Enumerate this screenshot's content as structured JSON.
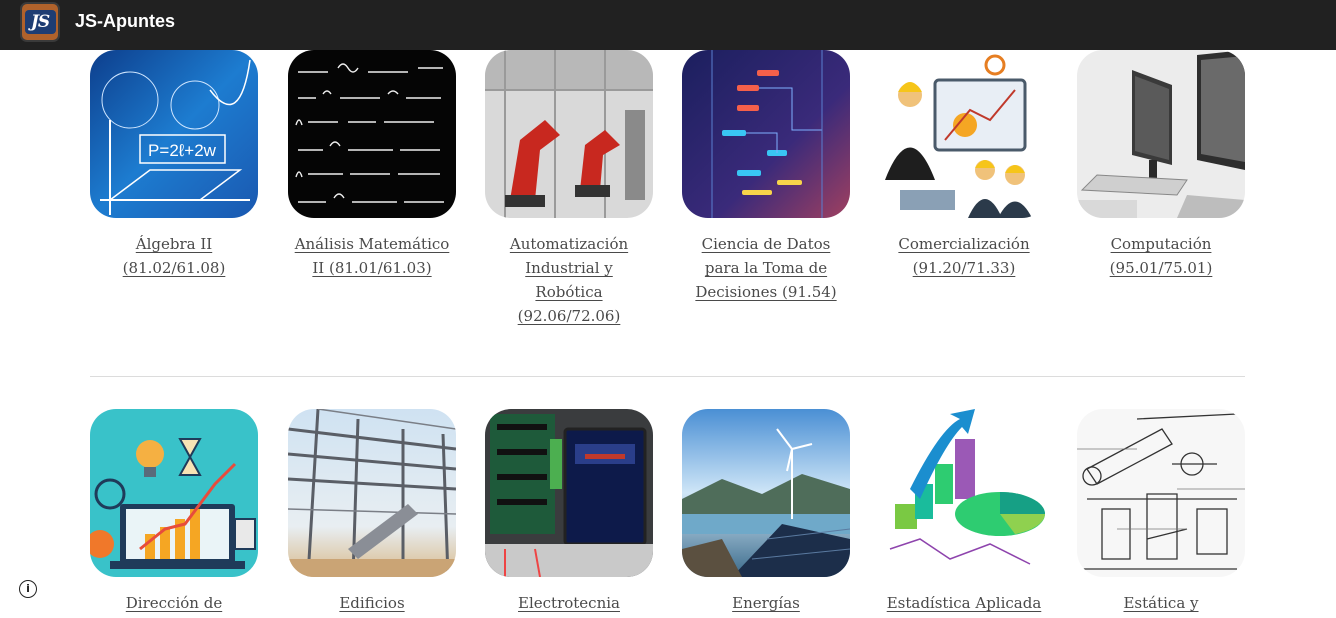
{
  "header": {
    "logo_text": "JS",
    "title": "JS-Apuntes"
  },
  "courses_row1": [
    {
      "label": "Álgebra II (81.02/61.08)",
      "image_text": "P=2ℓ+2w"
    },
    {
      "label": "Análisis Matemático II (81.01/61.03)"
    },
    {
      "label": "Automatización Industrial y Robótica (92.06/72.06)"
    },
    {
      "label": "Ciencia de Datos para la Toma de Decisiones (91.54)"
    },
    {
      "label": "Comercialización (91.20/71.33)"
    },
    {
      "label": "Computación (95.01/75.01)"
    }
  ],
  "courses_row2": [
    {
      "label": "Dirección de"
    },
    {
      "label": "Edificios"
    },
    {
      "label": "Electrotecnia"
    },
    {
      "label": "Energías"
    },
    {
      "label": "Estadística Aplicada"
    },
    {
      "label": "Estática y"
    }
  ],
  "footer": {
    "info_icon": "i"
  }
}
